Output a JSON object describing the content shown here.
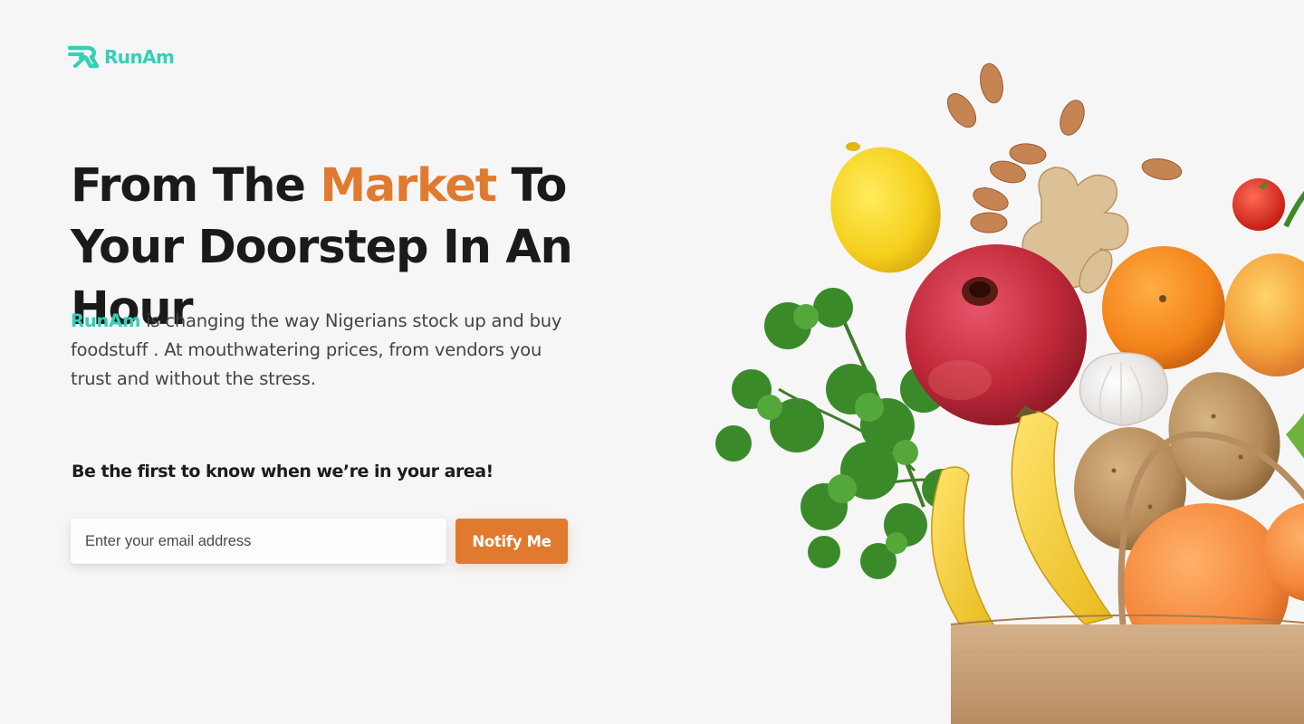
{
  "brand": {
    "name": "RunAm",
    "primary_color": "#35cfb7",
    "accent_color": "#e07a2f"
  },
  "hero": {
    "headline_part1": "From The ",
    "headline_accent": "Market",
    "headline_part2": " To Your Doorstep In An Hour",
    "description_brand": "RunAm",
    "description_rest": " is changing the way Nigerians stock up and buy foodstuff . At mouthwatering prices, from vendors you trust and without the stress."
  },
  "signup": {
    "callout": "Be the first to know when we’re in your area!",
    "email_placeholder": "Enter your email address",
    "button_label": "Notify Me"
  },
  "illustration": {
    "items": [
      "almond-icon",
      "lemon-icon",
      "ginger-icon",
      "tomato-icon",
      "pomegranate-icon",
      "orange-icon",
      "apple-icon",
      "parsley-icon",
      "garlic-icon",
      "potato-icon",
      "banana-icon",
      "grapefruit-icon",
      "paper-bag-icon"
    ]
  }
}
